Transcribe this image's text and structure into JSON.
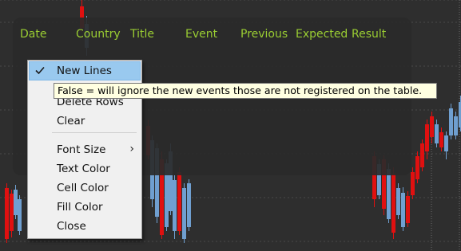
{
  "table": {
    "columns": [
      "Date",
      "Country",
      "Title",
      "Event",
      "Previous",
      "Expected",
      "Result"
    ],
    "text_color": "#9acd32"
  },
  "chart_colors": {
    "bull": "#6f9fd0",
    "bear": "#e01010",
    "background": "#2e2e2e"
  },
  "context_menu": {
    "items": [
      {
        "label": "New Lines",
        "checked": true,
        "highlighted": true
      },
      {
        "label": "Delete Rows"
      },
      {
        "label": "Clear"
      },
      {
        "label": "Font Size",
        "submenu": true
      },
      {
        "label": "Text Color"
      },
      {
        "label": "Cell Color"
      },
      {
        "label": "Fill Color"
      },
      {
        "label": "Close"
      }
    ],
    "check_icon": "checkmark-icon",
    "submenu_icon": "chevron-right-icon",
    "chevron_glyph": "›"
  },
  "tooltip": {
    "text": "False = will ignore the new events those are not registered on the table."
  }
}
